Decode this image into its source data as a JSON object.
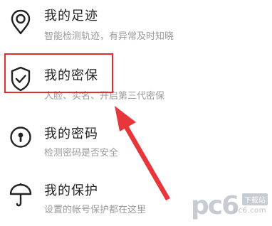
{
  "menu": {
    "items": [
      {
        "title": "我的足迹",
        "subtitle": "智能检测轨迹，有异常及时知晓",
        "icon": "location-pin-icon"
      },
      {
        "title": "我的密保",
        "subtitle": "人脸、实名、开启第三代密保",
        "icon": "shield-check-icon"
      },
      {
        "title": "我的密码",
        "subtitle": "检测密码是否安全",
        "icon": "keyhole-icon"
      },
      {
        "title": "我的保护",
        "subtitle": "设置的帐号保护都在这里",
        "icon": "umbrella-icon"
      }
    ]
  },
  "annotation": {
    "highlight_color": "#e22d2d",
    "arrow_color": "#e8363a"
  },
  "watermark": {
    "logo": "pc6",
    "tag": "下载站",
    "url": "pc6.com"
  }
}
